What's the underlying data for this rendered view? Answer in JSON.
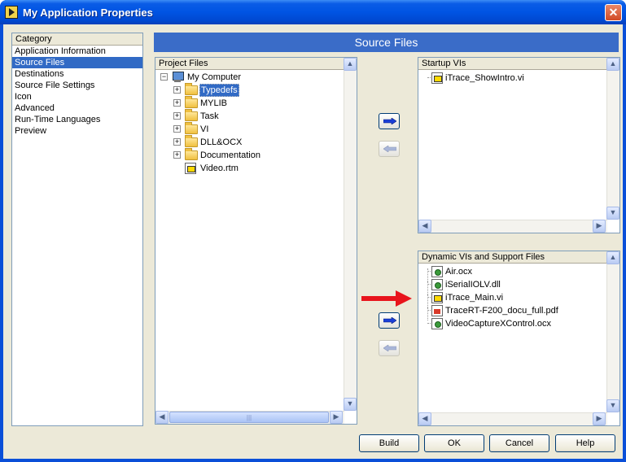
{
  "window": {
    "title": "My Application Properties"
  },
  "category": {
    "header": "Category",
    "items": [
      {
        "label": "Application Information",
        "selected": false
      },
      {
        "label": "Source Files",
        "selected": true
      },
      {
        "label": "Destinations",
        "selected": false
      },
      {
        "label": "Source File Settings",
        "selected": false
      },
      {
        "label": "Icon",
        "selected": false
      },
      {
        "label": "Advanced",
        "selected": false
      },
      {
        "label": "Run-Time Languages",
        "selected": false
      },
      {
        "label": "Preview",
        "selected": false
      }
    ]
  },
  "banner": {
    "title": "Source Files"
  },
  "project_files": {
    "header": "Project Files",
    "root": "My Computer",
    "items": [
      {
        "label": "Typedefs",
        "icon": "folder-icon",
        "selected": true
      },
      {
        "label": "MYLIB",
        "icon": "folder-icon"
      },
      {
        "label": "Task",
        "icon": "folder-icon"
      },
      {
        "label": "VI",
        "icon": "folder-icon"
      },
      {
        "label": "DLL&OCX",
        "icon": "folder-icon"
      },
      {
        "label": "Documentation",
        "icon": "folder-icon"
      },
      {
        "label": "Video.rtm",
        "icon": "rtm-file-icon"
      }
    ],
    "scroll_grip": "|||"
  },
  "startup_vis": {
    "header": "Startup VIs",
    "items": [
      {
        "label": "iTrace_ShowIntro.vi",
        "icon": "vi-file-icon"
      }
    ]
  },
  "dynamic_vis": {
    "header": "Dynamic VIs and Support Files",
    "items": [
      {
        "label": "Air.ocx",
        "icon": "ocx-file-icon"
      },
      {
        "label": "iSerialIOLV.dll",
        "icon": "dll-file-icon"
      },
      {
        "label": "iTrace_Main.vi",
        "icon": "vi-file-icon"
      },
      {
        "label": "TraceRT-F200_docu_full.pdf",
        "icon": "pdf-file-icon"
      },
      {
        "label": "VideoCaptureXControl.ocx",
        "icon": "ocx-file-icon"
      }
    ]
  },
  "footer": {
    "build": "Build",
    "ok": "OK",
    "cancel": "Cancel",
    "help": "Help"
  },
  "colors": {
    "selection": "#316ac5",
    "banner": "#3a6cc8",
    "annotation_arrow": "#e8141c",
    "add_arrow": "#1a3fd8"
  }
}
